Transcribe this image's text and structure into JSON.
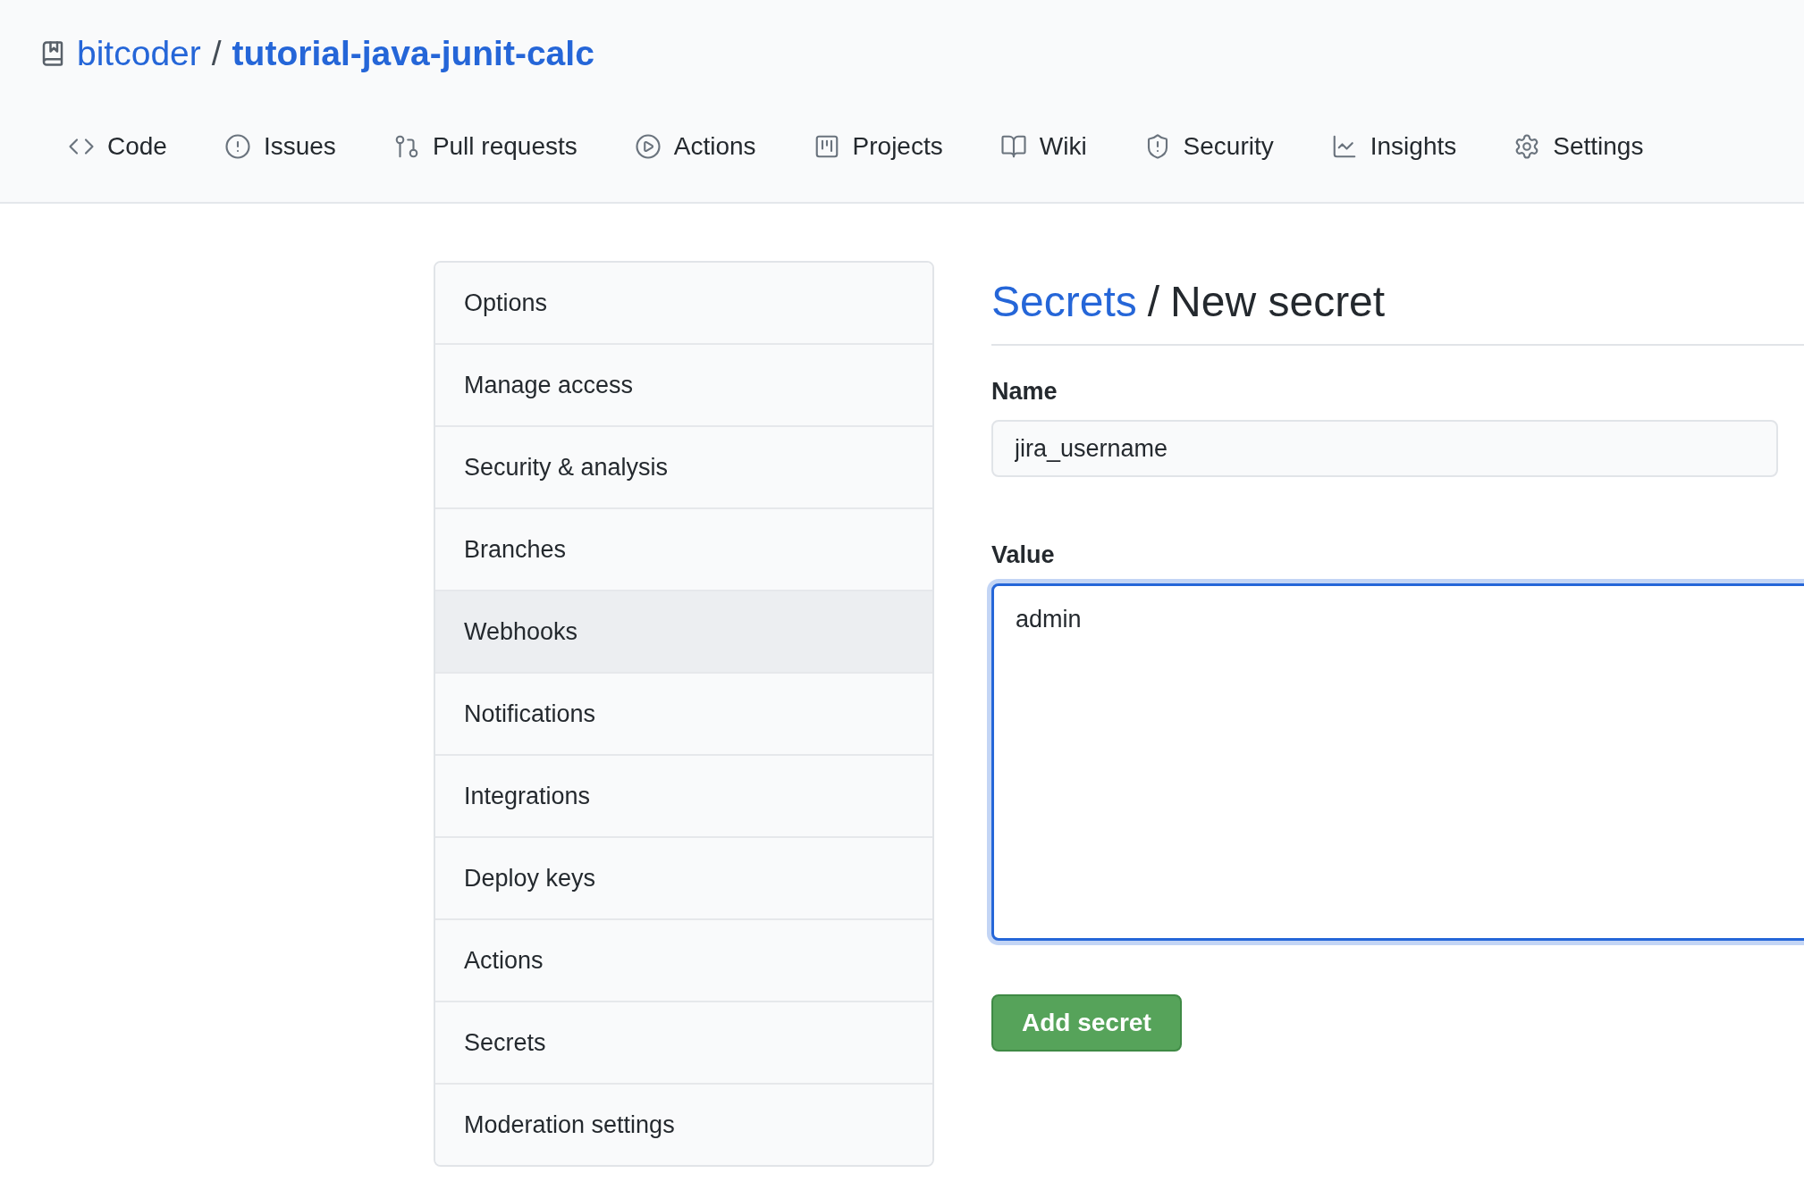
{
  "repo": {
    "owner": "bitcoder",
    "separator": "/",
    "name": "tutorial-java-junit-calc"
  },
  "tabs": [
    {
      "label": "Code",
      "selected": false
    },
    {
      "label": "Issues",
      "selected": false
    },
    {
      "label": "Pull requests",
      "selected": false
    },
    {
      "label": "Actions",
      "selected": false
    },
    {
      "label": "Projects",
      "selected": false
    },
    {
      "label": "Wiki",
      "selected": false
    },
    {
      "label": "Security",
      "selected": false
    },
    {
      "label": "Insights",
      "selected": false
    },
    {
      "label": "Settings",
      "selected": false
    }
  ],
  "sidebar": {
    "items": [
      {
        "label": "Options",
        "hovered": false
      },
      {
        "label": "Manage access",
        "hovered": false
      },
      {
        "label": "Security & analysis",
        "hovered": false
      },
      {
        "label": "Branches",
        "hovered": false
      },
      {
        "label": "Webhooks",
        "hovered": true
      },
      {
        "label": "Notifications",
        "hovered": false
      },
      {
        "label": "Integrations",
        "hovered": false
      },
      {
        "label": "Deploy keys",
        "hovered": false
      },
      {
        "label": "Actions",
        "hovered": false
      },
      {
        "label": "Secrets",
        "hovered": false
      },
      {
        "label": "Moderation settings",
        "hovered": false
      }
    ]
  },
  "heading": {
    "link": "Secrets",
    "separator": "/",
    "title": "New secret"
  },
  "form": {
    "name_label": "Name",
    "name_value": "jira_username",
    "value_label": "Value",
    "value_value": "admin",
    "value_focused": true,
    "submit": "Add secret"
  }
}
